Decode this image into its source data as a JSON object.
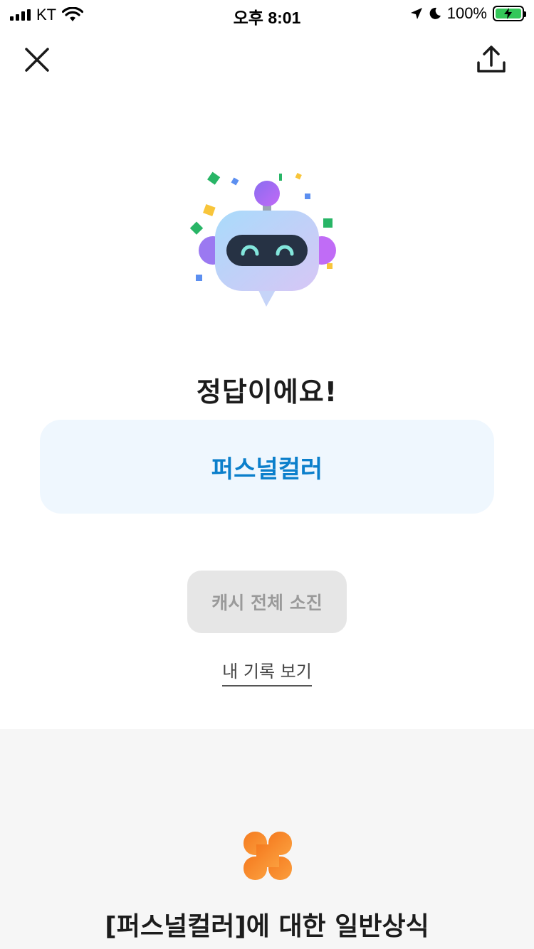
{
  "status_bar": {
    "carrier": "KT",
    "time": "오후 8:01",
    "battery": "100%"
  },
  "result": {
    "title": "정답이에요!",
    "answer": "퍼스널컬러"
  },
  "actions": {
    "spend_label": "캐시 전체 소진",
    "history_label": "내 기록 보기"
  },
  "info": {
    "title": "[퍼스널컬러]에 대한 일반상식"
  },
  "colors": {
    "accent": "#0b7fcb",
    "clover": "#f58a2a"
  }
}
